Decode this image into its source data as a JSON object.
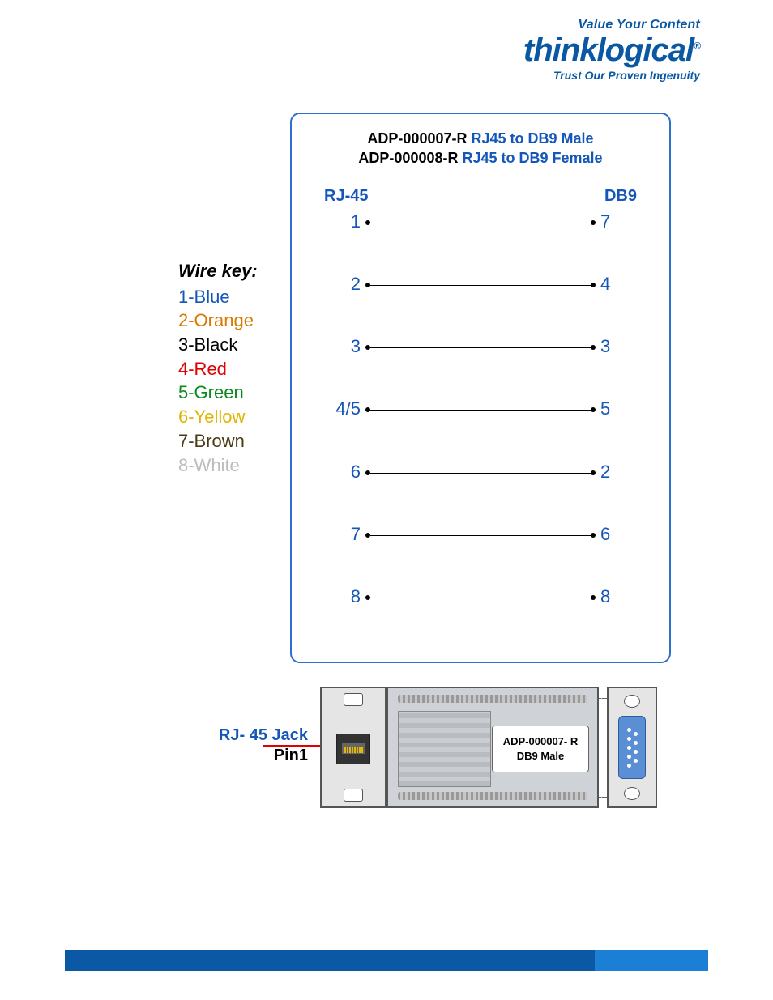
{
  "logo": {
    "tagline_top": "Value Your Content",
    "brand": "thinklogical",
    "registered": "®",
    "tagline_bottom": "Trust Our Proven Ingenuity"
  },
  "diagram": {
    "title1_part": "ADP-000007-R",
    "title1_blue": "RJ45 to DB9 Male",
    "title2_part": "ADP-000008-R",
    "title2_blue": "RJ45 to DB9 Female",
    "col_left": "RJ-45",
    "col_right": "DB9",
    "rows": [
      {
        "left": "1",
        "right": "7"
      },
      {
        "left": "2",
        "right": "4"
      },
      {
        "left": "3",
        "right": "3"
      },
      {
        "left": "4/5",
        "right": "5"
      },
      {
        "left": "6",
        "right": "2"
      },
      {
        "left": "7",
        "right": "6"
      },
      {
        "left": "8",
        "right": "8"
      }
    ]
  },
  "wire_key": {
    "title": "Wire key:",
    "items": [
      {
        "text": "1-Blue",
        "color": "#1556b9"
      },
      {
        "text": "2-Orange",
        "color": "#d97a00"
      },
      {
        "text": "3-Black",
        "color": "#000000"
      },
      {
        "text": "4-Red",
        "color": "#e10000"
      },
      {
        "text": "5-Green",
        "color": "#0a8a1f"
      },
      {
        "text": "6-Yellow",
        "color": "#e0b400"
      },
      {
        "text": "7-Brown",
        "color": "#4a3a15"
      },
      {
        "text": "8-White",
        "color": "#bdbdbd"
      }
    ]
  },
  "connector": {
    "rj_label_line1": "RJ- 45 Jack",
    "rj_label_line2": "Pin1",
    "body_label_line1": "ADP-000007- R",
    "body_label_line2": "DB9 Male"
  }
}
